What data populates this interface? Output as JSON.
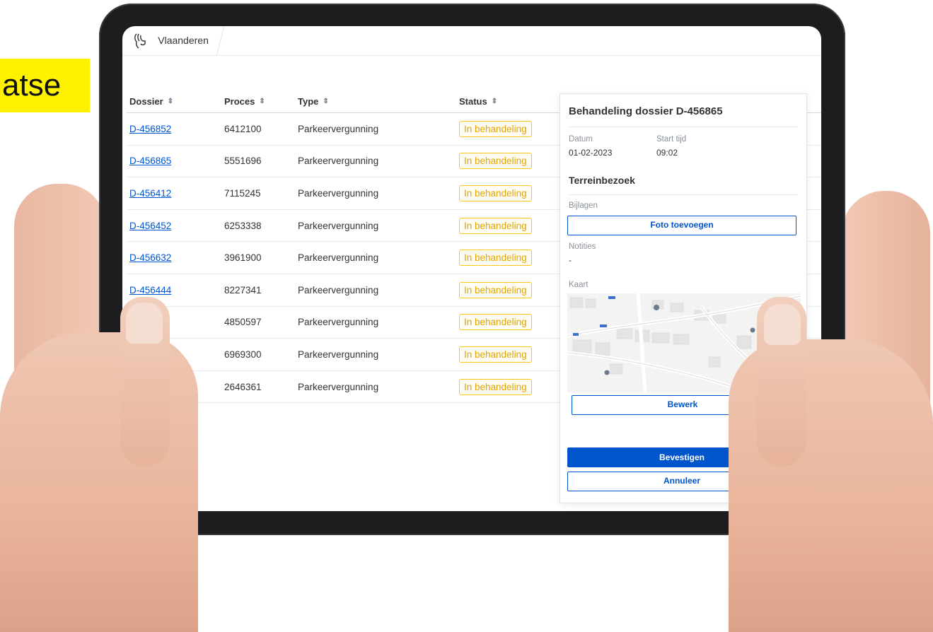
{
  "background": {
    "label": "atse",
    "label_color": "#fff200"
  },
  "app": {
    "brand": "Vlaanderen"
  },
  "table": {
    "columns": [
      "Dossier",
      "Proces",
      "Type",
      "Status"
    ],
    "rows": [
      {
        "dossier": "D-456852",
        "proces": "6412100",
        "type": "Parkeervergunning",
        "status": "In behandeling"
      },
      {
        "dossier": "D-456865",
        "proces": "5551696",
        "type": "Parkeervergunning",
        "status": "In behandeling"
      },
      {
        "dossier": "D-456412",
        "proces": "7115245",
        "type": "Parkeervergunning",
        "status": "In behandeling"
      },
      {
        "dossier": "D-456452",
        "proces": "6253338",
        "type": "Parkeervergunning",
        "status": "In behandeling"
      },
      {
        "dossier": "D-456632",
        "proces": "3961900",
        "type": "Parkeervergunning",
        "status": "In behandeling"
      },
      {
        "dossier": "D-456444",
        "proces": "8227341",
        "type": "Parkeervergunning",
        "status": "In behandeling"
      },
      {
        "dossier": "",
        "proces": "4850597",
        "type": "Parkeervergunning",
        "status": "In behandeling"
      },
      {
        "dossier": "",
        "proces": "6969300",
        "type": "Parkeervergunning",
        "status": "In behandeling"
      },
      {
        "dossier": "",
        "proces": "2646361",
        "type": "Parkeervergunning",
        "status": "In behandeling"
      }
    ]
  },
  "panel": {
    "title": "Behandeling dossier D-456865",
    "datum_label": "Datum",
    "datum_value": "01-02-2023",
    "start_label": "Start tijd",
    "start_value": "09:02",
    "section": "Terreinbezoek",
    "bijlagen_label": "Bijlagen",
    "foto_button": "Foto toevoegen",
    "notities_label": "Notities",
    "notities_value": "-",
    "kaart_label": "Kaart",
    "edit_button": "Bewerk",
    "confirm_button": "Bevestigen",
    "cancel_button": "Annuleer"
  },
  "colors": {
    "primary": "#0055cc",
    "badge_border": "#ffc515",
    "badge_text": "#e0a500",
    "device_frame": "#1d1d1f"
  },
  "icons": [
    "flemish-lion-logo-icon",
    "sort-icon",
    "map-pin-icon"
  ]
}
